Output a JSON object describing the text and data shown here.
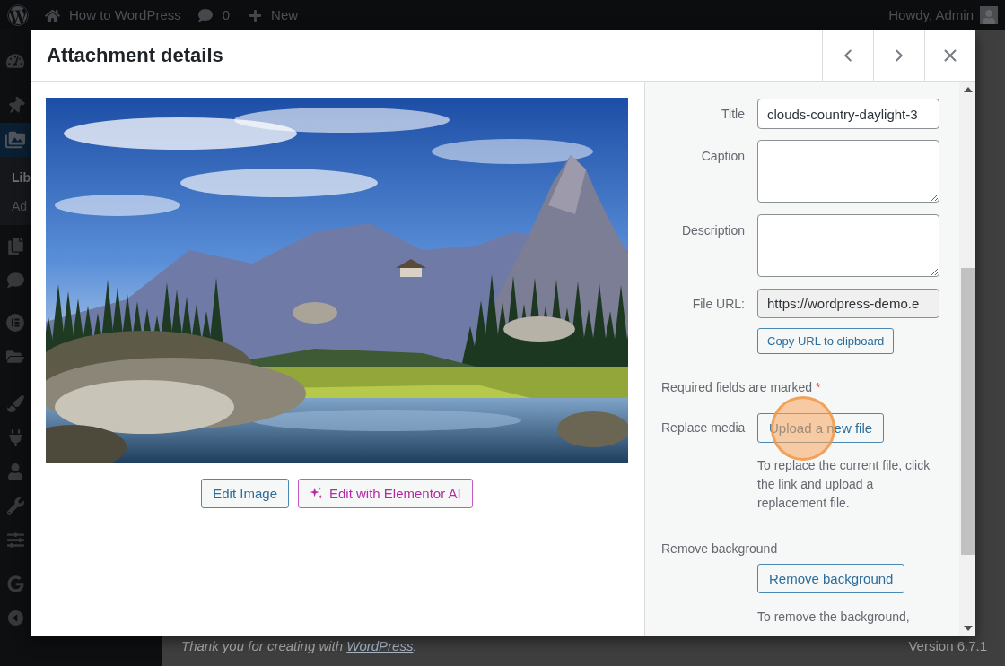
{
  "admin_bar": {
    "site_name": "How to WordPress",
    "comments": "0",
    "new_label": "New",
    "greeting": "Howdy, Admin"
  },
  "sidebar": {
    "items": [
      {
        "selected": false
      },
      {
        "selected": false
      },
      {
        "selected": true,
        "submenu": [
          {
            "label": "Lib",
            "selected": true
          },
          {
            "label": "Ad",
            "selected": false
          }
        ]
      },
      {
        "selected": false
      },
      {
        "selected": false
      },
      {
        "selected": false
      },
      {
        "selected": false
      },
      {
        "selected": false
      },
      {
        "selected": false
      },
      {
        "selected": false
      },
      {
        "selected": false
      },
      {
        "selected": false
      },
      {
        "selected": false
      },
      {
        "selected": false
      }
    ]
  },
  "modal": {
    "title": "Attachment details",
    "nav": [
      {
        "kind": "previous"
      },
      {
        "kind": "next"
      },
      {
        "kind": "close"
      }
    ]
  },
  "preview": {
    "buttons": [
      {
        "kind": "edit",
        "label": "Edit Image"
      },
      {
        "kind": "ai",
        "label": "Edit with Elementor AI"
      }
    ]
  },
  "details": {
    "fields": [
      {
        "kind": "input",
        "label": "Title",
        "value": "clouds-country-daylight-3"
      },
      {
        "kind": "textarea",
        "label": "Caption"
      },
      {
        "kind": "textarea",
        "label": "Description"
      },
      {
        "kind": "readonly",
        "label": "File URL:",
        "value": "https://wordpress-demo.e"
      }
    ],
    "copy_button": "Copy URL to clipboard",
    "required_note": {
      "text": "Required fields are marked",
      "mark": "*"
    },
    "replace_media": {
      "label": "Replace media",
      "button": "Upload a new file",
      "highlighted": true,
      "help": "To replace the current file, click the link and upload a replacement file."
    },
    "remove_background": {
      "label": "Remove background",
      "button": "Remove background",
      "help": "To remove the background,"
    }
  },
  "footer": {
    "credit": "Thank you for creating with",
    "link": "WordPress",
    "end": ".",
    "version": "Version 6.7.1"
  }
}
